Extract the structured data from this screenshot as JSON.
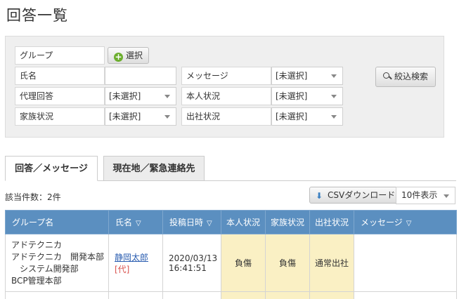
{
  "title": "回答一覧",
  "filters": {
    "group_label": "グループ",
    "select_button": "選択",
    "name_label": "氏名",
    "name_value": "",
    "message_label": "メッセージ",
    "message_value": "[未選択]",
    "proxy_label": "代理回答",
    "proxy_value": "[未選択]",
    "self_status_label": "本人状況",
    "self_status_value": "[未選択]",
    "family_label": "家族状況",
    "family_value": "[未選択]",
    "office_label": "出社状況",
    "office_value": "[未選択]",
    "search_button": "絞込検索"
  },
  "tabs": [
    {
      "label": "回答／メッセージ",
      "active": true
    },
    {
      "label": "現在地／緊急連絡先",
      "active": false
    }
  ],
  "result_count_text": "該当件数：2件",
  "csv_button": "CSVダウンロード",
  "page_size": "10件表示",
  "table": {
    "headers": [
      "グループ名",
      "氏名",
      "投稿日時",
      "本人状況",
      "家族状況",
      "出社状況",
      "メッセージ"
    ],
    "rows": [
      {
        "group_lines": [
          "アドテクニカ",
          "アドテクニカ　開発本部",
          "　システム開発部",
          "BCP管理本部"
        ],
        "name": "静岡太郎",
        "proxy": "[代]",
        "date": "2020/03/13",
        "time": "16:41:51",
        "self_status": "負傷",
        "family_status": "負傷",
        "office_status": "通常出社",
        "message": ""
      }
    ]
  },
  "colors": {
    "header_bg": "#5b8fc0",
    "status_cell_bg": "#faf0c4",
    "panel_bg": "#efefef",
    "link": "#2a5db0",
    "proxy_tag": "#d9534f"
  },
  "icons": [
    "plus-icon",
    "search-icon",
    "download-icon",
    "sort-icon",
    "chevron-down-icon"
  ]
}
